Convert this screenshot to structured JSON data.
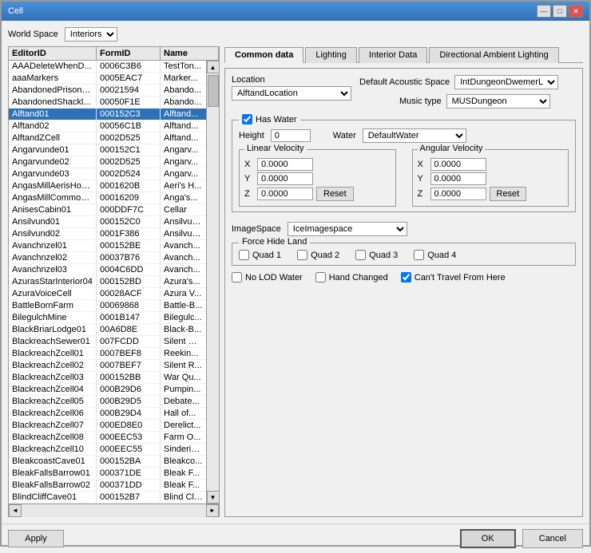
{
  "window": {
    "title": "Cell",
    "title_buttons": {
      "minimize": "—",
      "maximize": "□",
      "close": "✕"
    }
  },
  "world_space": {
    "label": "World Space",
    "value": "Interiors",
    "options": [
      "Interiors"
    ]
  },
  "tabs": [
    {
      "id": "common",
      "label": "Common data",
      "active": true
    },
    {
      "id": "lighting",
      "label": "Lighting",
      "active": false
    },
    {
      "id": "interior",
      "label": "Interior Data",
      "active": false
    },
    {
      "id": "directional",
      "label": "Directional Ambient Lighting",
      "active": false
    }
  ],
  "table": {
    "columns": [
      "EditorID",
      "FormID",
      "Name"
    ],
    "rows": [
      {
        "editor": "AAADeleteWhenD...",
        "form": "0006C3B6",
        "name": "TestTon...",
        "selected": false
      },
      {
        "editor": "aaaMarkers",
        "form": "0005EAC7",
        "name": "Marker...",
        "selected": false
      },
      {
        "editor": "AbandonedPrison0...",
        "form": "00021594",
        "name": "Abando...",
        "selected": false
      },
      {
        "editor": "AbandonedShackl...",
        "form": "00050F1E",
        "name": "Abando...",
        "selected": false
      },
      {
        "editor": "Alftand01",
        "form": "000152C3",
        "name": "Alftand...",
        "selected": true
      },
      {
        "editor": "Alftand02",
        "form": "00056C1B",
        "name": "Alftand...",
        "selected": false
      },
      {
        "editor": "AlftandZCell",
        "form": "0002D525",
        "name": "Alftand...",
        "selected": false
      },
      {
        "editor": "Angarvunde01",
        "form": "000152C1",
        "name": "Angarv...",
        "selected": false
      },
      {
        "editor": "Angarvunde02",
        "form": "0002D525",
        "name": "Angarv...",
        "selected": false
      },
      {
        "editor": "Angarvunde03",
        "form": "0002D524",
        "name": "Angarv...",
        "selected": false
      },
      {
        "editor": "AngasMillAerisHouse",
        "form": "0001620B",
        "name": "Aeri's H...",
        "selected": false
      },
      {
        "editor": "AngasMillCommon...",
        "form": "0001620​9",
        "name": "Anga's...",
        "selected": false
      },
      {
        "editor": "AnisesCabin01",
        "form": "000DDF7C",
        "name": "Cellar",
        "selected": false
      },
      {
        "editor": "Ansilvund01",
        "form": "000152C0",
        "name": "Ansilvun...",
        "selected": false
      },
      {
        "editor": "Ansilvund02",
        "form": "0001F386",
        "name": "Ansilvun...",
        "selected": false
      },
      {
        "editor": "Avanchnzel01",
        "form": "000152BE",
        "name": "Avanch...",
        "selected": false
      },
      {
        "editor": "Avanchnzel02",
        "form": "00037B76",
        "name": "Avanch...",
        "selected": false
      },
      {
        "editor": "Avanchnzel03",
        "form": "0004C6DD",
        "name": "Avanch...",
        "selected": false
      },
      {
        "editor": "AzurasStarInterior04",
        "form": "000152BD",
        "name": "Azura's...",
        "selected": false
      },
      {
        "editor": "AzuraVoiceCell",
        "form": "00028ACF",
        "name": "Azura V...",
        "selected": false
      },
      {
        "editor": "BattleBornFarm",
        "form": "00069868",
        "name": "Battle-B...",
        "selected": false
      },
      {
        "editor": "BilegulchMine",
        "form": "0001B147",
        "name": "Bilegulc...",
        "selected": false
      },
      {
        "editor": "BlackBriarLodge01",
        "form": "00A6D8E",
        "name": "Black-B...",
        "selected": false
      },
      {
        "editor": "BlackreachSewer01",
        "form": "007FCDD",
        "name": "Silent Ci...",
        "selected": false
      },
      {
        "editor": "BlackreachZcell01",
        "form": "0007BEF8",
        "name": "Reekin...",
        "selected": false
      },
      {
        "editor": "BlackreachZcell02",
        "form": "0007BEF7",
        "name": "Silent R...",
        "selected": false
      },
      {
        "editor": "BlackreachZcell03",
        "form": "000152BB",
        "name": "War Qu...",
        "selected": false
      },
      {
        "editor": "BlackreachZcell04",
        "form": "000B29D6",
        "name": "Pumpin...",
        "selected": false
      },
      {
        "editor": "BlackreachZcell05",
        "form": "000B29D5",
        "name": "Debate...",
        "selected": false
      },
      {
        "editor": "BlackreachZcell06",
        "form": "000B29D4",
        "name": "Hall of...",
        "selected": false
      },
      {
        "editor": "BlackreachZcell07",
        "form": "000E​D8E0",
        "name": "Derelict...",
        "selected": false
      },
      {
        "editor": "BlackreachZcell08",
        "form": "000EEC53",
        "name": "Farm O...",
        "selected": false
      },
      {
        "editor": "BlackreachZcell10",
        "form": "000EEC55",
        "name": "Sinderio...",
        "selected": false
      },
      {
        "editor": "BleakcoastCave01",
        "form": "000152BA",
        "name": "Bleakco...",
        "selected": false
      },
      {
        "editor": "BleakFallsBarrow01",
        "form": "000371DE",
        "name": "Bleak F...",
        "selected": false
      },
      {
        "editor": "BleakFallsBarrow02",
        "form": "000371DD",
        "name": "Bleak F...",
        "selected": false
      },
      {
        "editor": "BlindCliffCave01",
        "form": "000152B7",
        "name": "Blind Cli...",
        "selected": false
      }
    ]
  },
  "common_data": {
    "location_label": "Location",
    "location_value": "AlftandLocation",
    "default_acoustic_space_label": "Default Acoustic Space",
    "acoustic_space_value": "IntDungeonDwemerLa...",
    "music_type_label": "Music type",
    "music_type_value": "MUSDungeon",
    "has_water_label": "Has Water",
    "has_water_checked": true,
    "height_label": "Height",
    "height_value": "0",
    "water_label": "Water",
    "water_value": "DefaultWater",
    "linear_velocity_label": "Linear Velocity",
    "angular_velocity_label": "Angular Velocity",
    "x_label": "X",
    "y_label": "Y",
    "z_label": "Z",
    "lv_x": "0.0000",
    "lv_y": "0.0000",
    "lv_z": "0.0000",
    "av_x": "0.0000",
    "av_y": "0.0000",
    "av_z": "0.0000",
    "reset_label": "Reset",
    "image_space_label": "ImageSpace",
    "image_space_value": "IceImagespace",
    "force_hide_land_label": "Force Hide Land",
    "quad1_label": "Quad 1",
    "quad2_label": "Quad 2",
    "quad3_label": "Quad 3",
    "quad4_label": "Quad 4",
    "quad1_checked": false,
    "quad2_checked": false,
    "quad3_checked": false,
    "quad4_checked": false,
    "no_lod_water_label": "No LOD Water",
    "no_lod_water_checked": false,
    "hand_changed_label": "Hand Changed",
    "hand_changed_checked": false,
    "cant_travel_label": "Can't Travel From Here",
    "cant_travel_checked": true
  },
  "footer": {
    "apply_label": "Apply",
    "ok_label": "OK",
    "cancel_label": "Cancel"
  }
}
